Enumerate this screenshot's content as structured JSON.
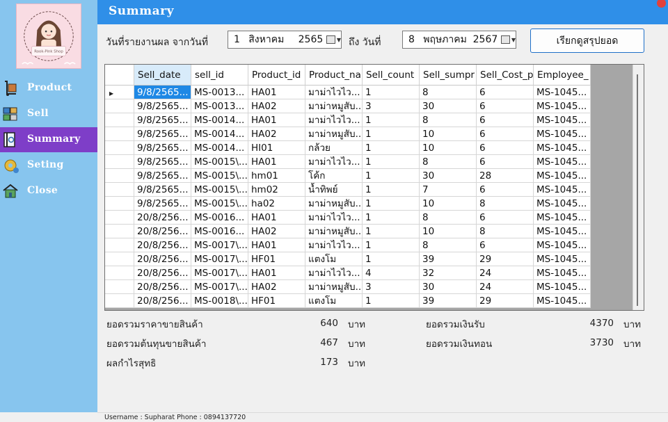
{
  "header": {
    "title": "Summary"
  },
  "logo": {
    "text": "Rook-Pink Shop"
  },
  "sidebar": {
    "items": [
      {
        "label": "Product",
        "icon": "hand-truck-icon"
      },
      {
        "label": "Sell",
        "icon": "boxes-icon"
      },
      {
        "label": "Summary",
        "icon": "report-book-icon",
        "active": true
      },
      {
        "label": "Seting",
        "icon": "gear-icon"
      },
      {
        "label": "Close",
        "icon": "home-exit-icon"
      }
    ]
  },
  "filter": {
    "from_label": "วันที่รายงานผล จากวันที่",
    "to_label": "ถึง วันที่",
    "from_date": {
      "day": "1",
      "month": "สิงหาคม",
      "year": "2565"
    },
    "to_date": {
      "day": "8",
      "month": "พฤษภาคม",
      "year": "2567"
    },
    "button_label": "เรียกดูสรุปยอด"
  },
  "grid": {
    "columns": [
      "Sell_date",
      "sell_id",
      "Product_id",
      "Product_na",
      "Sell_count",
      "Sell_sumpr",
      "Sell_Cost_p",
      "Employee_"
    ],
    "rows": [
      [
        "9/8/2565...",
        "MS-0013...",
        "HA01",
        "มาม่าไวไว...",
        "1",
        "8",
        "6",
        "MS-1045..."
      ],
      [
        "9/8/2565...",
        "MS-0013...",
        "HA02",
        "มาม่าหมูสับ...",
        "3",
        "30",
        "6",
        "MS-1045..."
      ],
      [
        "9/8/2565...",
        "MS-0014...",
        "HA01",
        "มาม่าไวไว...",
        "1",
        "8",
        "6",
        "MS-1045..."
      ],
      [
        "9/8/2565...",
        "MS-0014...",
        "HA02",
        "มาม่าหมูสับ...",
        "1",
        "10",
        "6",
        "MS-1045..."
      ],
      [
        "9/8/2565...",
        "MS-0014...",
        "HI01",
        "กล้วย",
        "1",
        "10",
        "6",
        "MS-1045..."
      ],
      [
        "9/8/2565...",
        "MS-0015\\...",
        "HA01",
        "มาม่าไวไว...",
        "1",
        "8",
        "6",
        "MS-1045..."
      ],
      [
        "9/8/2565...",
        "MS-0015\\...",
        "hm01",
        "โค้ก",
        "1",
        "30",
        "28",
        "MS-1045..."
      ],
      [
        "9/8/2565...",
        "MS-0015\\...",
        "hm02",
        "น้ำทิพย์",
        "1",
        "7",
        "6",
        "MS-1045..."
      ],
      [
        "9/8/2565...",
        "MS-0015\\...",
        "ha02",
        "มาม่าหมูสับ...",
        "1",
        "10",
        "8",
        "MS-1045..."
      ],
      [
        "20/8/256...",
        "MS-0016...",
        "HA01",
        "มาม่าไวไว...",
        "1",
        "8",
        "6",
        "MS-1045..."
      ],
      [
        "20/8/256...",
        "MS-0016...",
        "HA02",
        "มาม่าหมูสับ...",
        "1",
        "10",
        "8",
        "MS-1045..."
      ],
      [
        "20/8/256...",
        "MS-0017\\...",
        "HA01",
        "มาม่าไวไว...",
        "1",
        "8",
        "6",
        "MS-1045..."
      ],
      [
        "20/8/256...",
        "MS-0017\\...",
        "HF01",
        "แตงโม",
        "1",
        "39",
        "29",
        "MS-1045..."
      ],
      [
        "20/8/256...",
        "MS-0017\\...",
        "HA01",
        "มาม่าไวไว...",
        "4",
        "32",
        "24",
        "MS-1045..."
      ],
      [
        "20/8/256...",
        "MS-0017\\...",
        "HA02",
        "มาม่าหมูสับ...",
        "3",
        "30",
        "24",
        "MS-1045..."
      ],
      [
        "20/8/256...",
        "MS-0018\\...",
        "HF01",
        "แตงโม",
        "1",
        "39",
        "29",
        "MS-1045..."
      ]
    ]
  },
  "totals": {
    "sales_label": "ยอดรวมราคาขายสินค้า",
    "sales_value": "640",
    "cost_label": "ยอดรวมต้นทุนขายสินค้า",
    "cost_value": "467",
    "profit_label": "ผลกำไรสุทธิ",
    "profit_value": "173",
    "received_label": "ยอดรวมเงินรับ",
    "received_value": "4370",
    "change_label": "ยอดรวมเงินทอน",
    "change_value": "3730",
    "unit": "บาท"
  },
  "status": {
    "text": "Username :   Supharat  Phone :  0894137720"
  },
  "colors": {
    "sidebar": "#87c5ee",
    "header": "#2f8fe8",
    "active_nav": "#7e3ec8",
    "selection": "#1e88e5"
  }
}
